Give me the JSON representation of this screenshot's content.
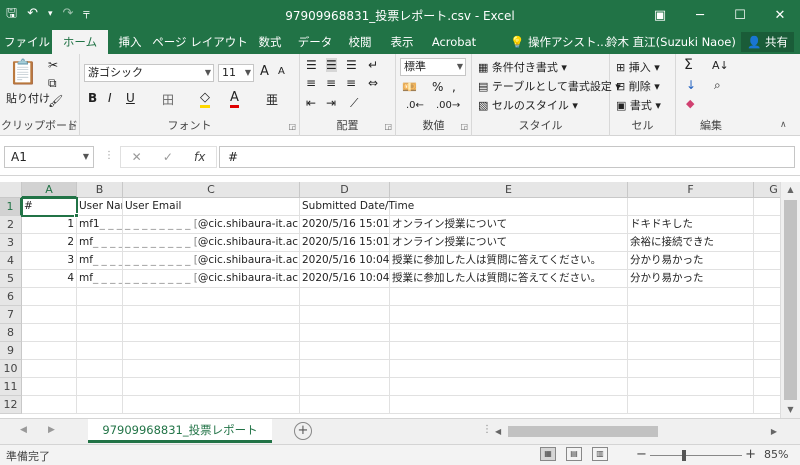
{
  "window": {
    "title": "97909968831_投票レポート.csv - Excel",
    "minimize": "─",
    "maximize": "☐",
    "close": "✕",
    "ribbon_display": "▣"
  },
  "qat": {
    "save": "🖫",
    "undo": "↶",
    "undo_dd": "▾",
    "redo": "↷",
    "customize": "╤"
  },
  "tabs": [
    {
      "label": "ファイル"
    },
    {
      "label": "ホーム"
    },
    {
      "label": "挿入"
    },
    {
      "label": "ページ レイアウト"
    },
    {
      "label": "数式"
    },
    {
      "label": "データ"
    },
    {
      "label": "校閲"
    },
    {
      "label": "表示"
    },
    {
      "label": "Acrobat"
    }
  ],
  "tell_me": "操作アシスト...",
  "user": "鈴木 直江(Suzuki Naoe)",
  "share": "共有",
  "ribbon": {
    "clipboard": {
      "label": "クリップボード",
      "paste": "貼り付け"
    },
    "font": {
      "label": "フォント",
      "name": "游ゴシック",
      "size": "11",
      "grow": "A",
      "shrink": "A",
      "bold": "B",
      "italic": "I",
      "underline": "U",
      "border": "田",
      "fill": "◇",
      "color": "A",
      "phonetic": "亜"
    },
    "alignment": {
      "label": "配置"
    },
    "number": {
      "label": "数値",
      "format": "標準",
      "percent": "%",
      "comma": ","
    },
    "styles": {
      "label": "スタイル",
      "conditional": "条件付き書式",
      "table": "テーブルとして書式設定",
      "cell_styles": "セルのスタイル"
    },
    "cells": {
      "label": "セル",
      "insert": "挿入",
      "delete": "削除",
      "format": "書式"
    },
    "editing": {
      "label": "編集",
      "sum": "Σ",
      "sort": "A↓",
      "fill": "↓",
      "find": "⌕",
      "clear": "◆"
    }
  },
  "formula_bar": {
    "name_box": "A1",
    "cancel": "✕",
    "enter": "✓",
    "fx": "fx",
    "content": "#"
  },
  "columns": [
    "A",
    "B",
    "C",
    "D",
    "E",
    "F",
    "G"
  ],
  "rows": [
    "1",
    "2",
    "3",
    "4",
    "5",
    "6",
    "7",
    "8",
    "9",
    "10",
    "11",
    "12"
  ],
  "cells": {
    "headers": [
      "#",
      "User Name",
      "User Email",
      "Submitted Date/Time",
      "",
      ""
    ],
    "data": [
      [
        "1",
        "mf1",
        "@cic.shibaura-it.ac.jp",
        "2020/5/16 15:01",
        "オンライン授業について",
        "ドキドキした"
      ],
      [
        "2",
        "mf",
        "@cic.shibaura-it.ac.jp",
        "2020/5/16 15:01",
        "オンライン授業について",
        "余裕に接続できた"
      ],
      [
        "3",
        "mf",
        "@cic.shibaura-it.ac.jp",
        "2020/5/16 10:04",
        "授業に参加した人は質問に答えてください。",
        "分かり易かった"
      ],
      [
        "4",
        "mf",
        "@cic.shibaura-it.ac.jp",
        "2020/5/16 10:04",
        "授業に参加した人は質問に答えてください。",
        "分かり易かった"
      ]
    ]
  },
  "sheet": {
    "name": "97909968831_投票レポート",
    "add": "+"
  },
  "status": {
    "ready": "準備完了",
    "zoom": "85%",
    "zoom_minus": "−",
    "zoom_plus": "+"
  }
}
